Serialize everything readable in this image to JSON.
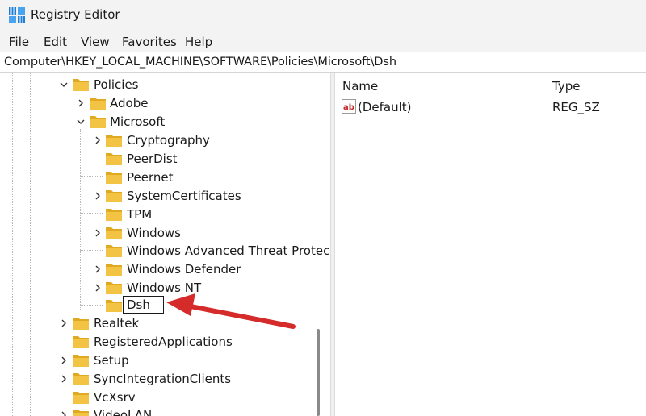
{
  "window": {
    "title": "Registry Editor"
  },
  "menu": [
    "File",
    "Edit",
    "View",
    "Favorites",
    "Help"
  ],
  "address": "Computer\\HKEY_LOCAL_MACHINE\\SOFTWARE\\Policies\\Microsoft\\Dsh",
  "tree": {
    "policies": "Policies",
    "adobe": "Adobe",
    "microsoft": "Microsoft",
    "cryptography": "Cryptography",
    "peerdist": "PeerDist",
    "peernet": "Peernet",
    "systemcertificates": "SystemCertificates",
    "tpm": "TPM",
    "windows": "Windows",
    "windows_atp": "Windows Advanced Threat Protec",
    "windows_defender": "Windows Defender",
    "windows_nt": "Windows NT",
    "dsh": "Dsh",
    "realtek": "Realtek",
    "registeredapplications": "RegisteredApplications",
    "setup": "Setup",
    "syncintegrationclients": "SyncIntegrationClients",
    "vcxsrv": "VcXsrv",
    "videolan": "VideoLAN"
  },
  "values": {
    "columns": {
      "name": "Name",
      "type": "Type"
    },
    "rows": [
      {
        "name": "(Default)",
        "type": "REG_SZ",
        "icon": "string-value-icon"
      }
    ]
  },
  "colors": {
    "folder": "#f3c443",
    "folder_dark": "#e0a922",
    "arrow": "#d62b2b",
    "accent": "#0f6cbd"
  }
}
